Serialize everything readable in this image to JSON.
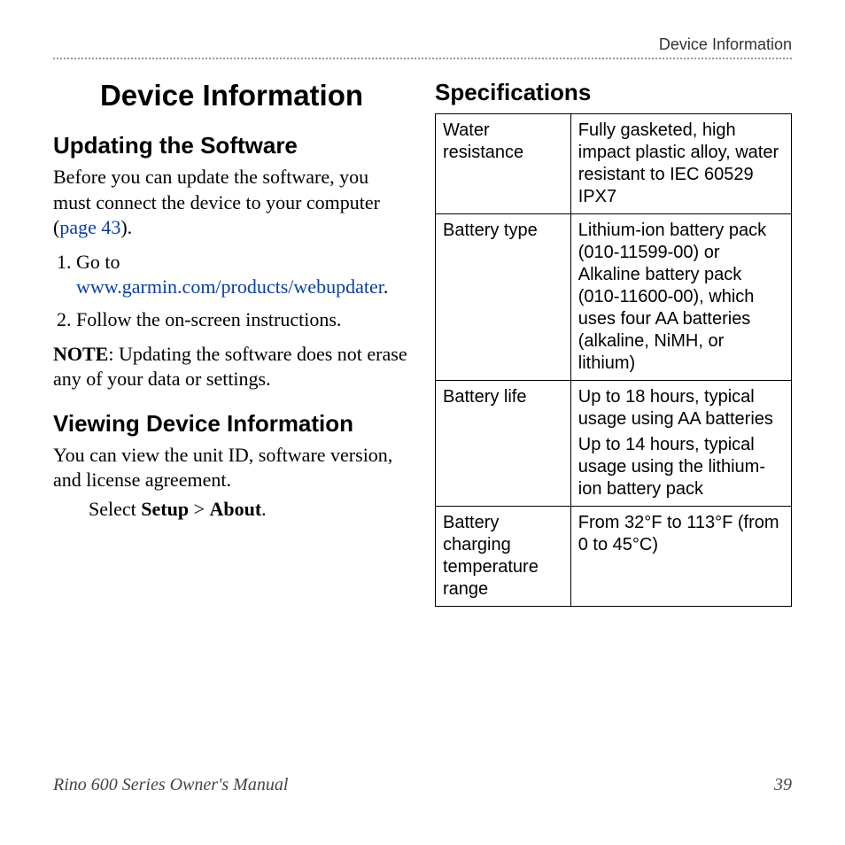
{
  "header": {
    "running_head": "Device Information"
  },
  "left": {
    "title": "Device Information",
    "updating": {
      "heading": "Updating the Software",
      "intro_pre": "Before you can update the software, you must connect the device to your computer (",
      "intro_link": "page 43",
      "intro_post": ").",
      "step1_pre": "Go to ",
      "step1_link": "www.garmin.com/products/webupdater",
      "step1_post": ".",
      "step2": "Follow the on-screen instructions.",
      "note_label": "NOTE",
      "note_body": ": Updating the software does not erase any of your data or settings."
    },
    "viewing": {
      "heading": "Viewing Device Information",
      "body": "You can view the unit ID, software version, and license agreement.",
      "instr_pre": "Select ",
      "instr_setup": "Setup",
      "instr_gt": " > ",
      "instr_about": "About",
      "instr_post": "."
    }
  },
  "right": {
    "heading": "Specifications",
    "rows": [
      {
        "label": "Water resistance",
        "value": "Fully gasketed, high impact plastic alloy, water resistant to IEC 60529 IPX7"
      },
      {
        "label": "Battery type",
        "value": "Lithium-ion battery pack (010-11599-00) or Alkaline battery pack (010-11600-00), which uses four AA batteries (alkaline, NiMH, or lithium)"
      },
      {
        "label": "Battery life",
        "paragraphs": [
          "Up to 18 hours, typical usage using AA batteries",
          "Up to 14 hours, typical usage using the lithium-ion battery pack"
        ]
      },
      {
        "label": "Battery charging temperature range",
        "value": "From 32°F to 113°F (from 0 to 45°C)"
      }
    ]
  },
  "footer": {
    "manual": "Rino 600 Series Owner's Manual",
    "page": "39"
  }
}
